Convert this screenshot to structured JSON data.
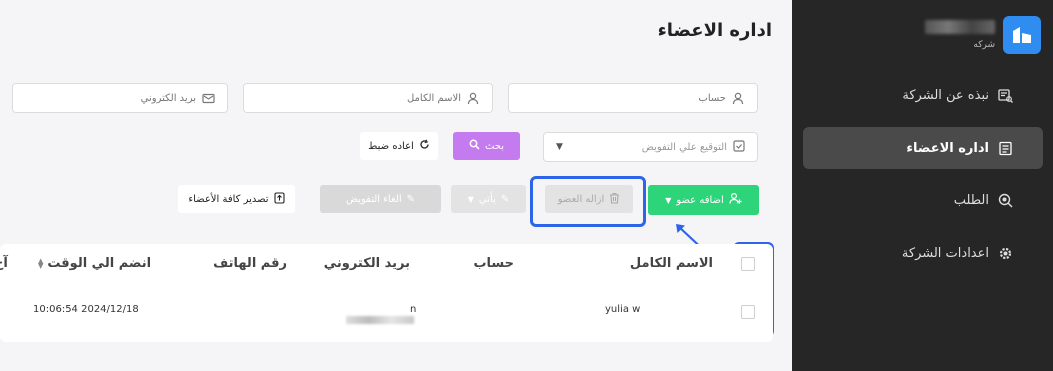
{
  "sidebar": {
    "company_label": "شركه",
    "items": [
      {
        "label": "نبذه عن الشركة",
        "icon": "company-info-icon",
        "active": false
      },
      {
        "label": "اداره الاعضاء",
        "icon": "members-icon",
        "active": true
      },
      {
        "label": "الطلب",
        "icon": "order-icon",
        "active": false
      },
      {
        "label": "اعدادات الشركة",
        "icon": "gear-icon",
        "active": false
      }
    ]
  },
  "page": {
    "title": "اداره الاعضاء"
  },
  "filters": {
    "account_placeholder": "حساب",
    "fullname_placeholder": "الاسم الكامل",
    "email_placeholder": "بريد الكتروني",
    "authorization_placeholder": "التوقيع علي التفويض",
    "search_label": "بحث",
    "reset_label": "اعاده ضبط"
  },
  "toolbar": {
    "add_member_label": "اضافه عضو",
    "remove_member_label": "ازاله العضو",
    "leave_label": "يأتي",
    "cancel_authorization_label": "الغاء التفويض",
    "export_label": "تصدير كافة الأعضاء"
  },
  "table": {
    "headers": {
      "fullname": "الاسم الكامل",
      "account": "حساب",
      "email": "بريد الكتروني",
      "phone": "رقم الهاتف",
      "joined": "انضم الي الوقت",
      "extra": "آخ"
    },
    "rows": [
      {
        "fullname": "yulia w",
        "account": "",
        "email": "n",
        "phone": "",
        "joined": "10:06:54 2024/12/18"
      }
    ]
  },
  "colors": {
    "sidebar_bg": "#262626",
    "accent_green": "#2ed47a",
    "accent_purple": "#c57bf0",
    "highlight_blue": "#2d64e8"
  }
}
